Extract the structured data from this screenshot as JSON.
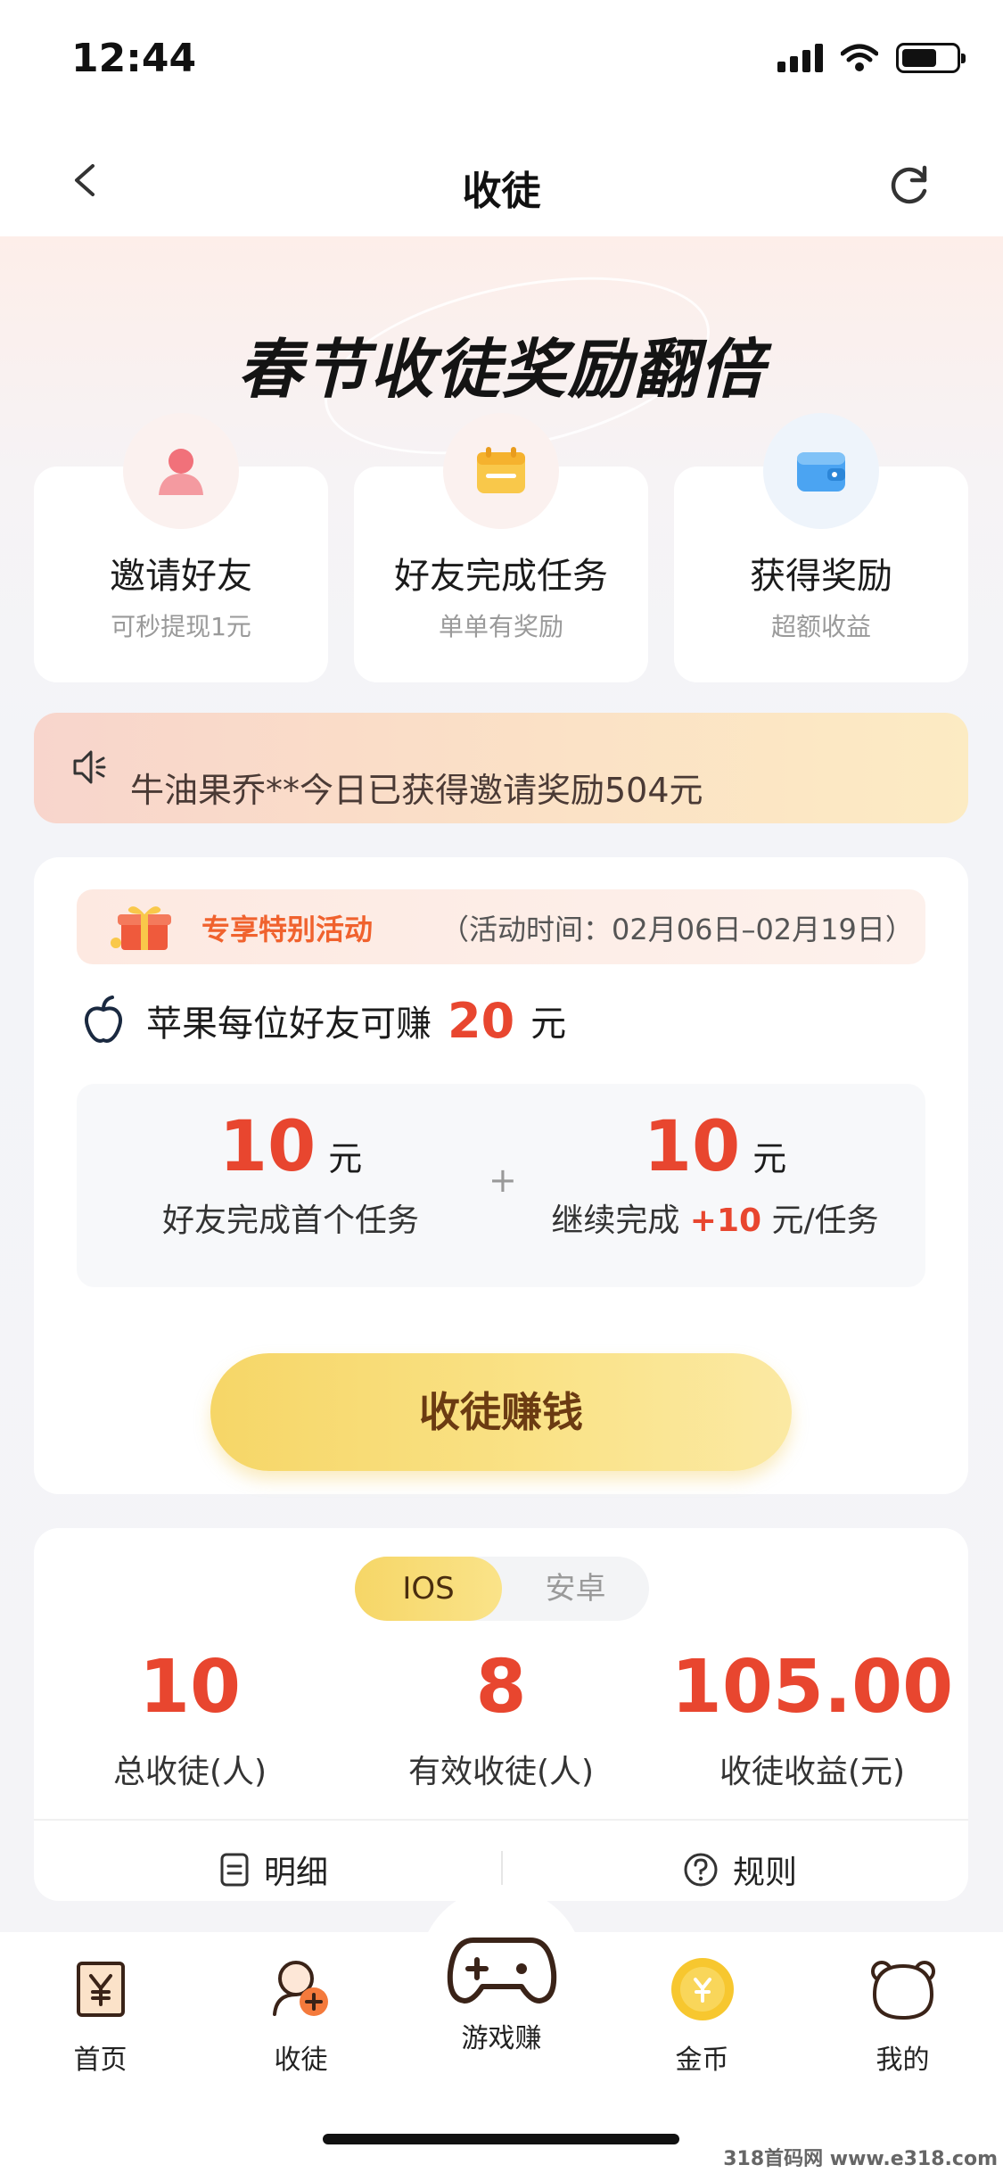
{
  "status_bar": {
    "time": "12:44"
  },
  "nav": {
    "title": "收徒"
  },
  "hero": {
    "title": "春节收徒奖励翻倍"
  },
  "steps": [
    {
      "title": "邀请好友",
      "subtitle": "可秒提现1元",
      "icon": "friend-avatar-icon"
    },
    {
      "title": "好友完成任务",
      "subtitle": "单单有奖励",
      "icon": "task-calendar-icon"
    },
    {
      "title": "获得奖励",
      "subtitle": "超额收益",
      "icon": "wallet-icon"
    }
  ],
  "ticker": {
    "text": "牛油果乔**今日已获得邀请奖励504元",
    "icon": "speaker-icon"
  },
  "activity": {
    "name": "专享特别活动",
    "time": "（活动时间：02月06日–02月19日）",
    "apple_text": "苹果每位好友可赚",
    "apple_amount": "20",
    "apple_unit": "元",
    "reward_left_value": "10",
    "reward_left_unit": "元",
    "reward_left_desc": "好友完成首个任务",
    "reward_plus": "+",
    "reward_right_value": "10",
    "reward_right_unit": "元",
    "reward_right_desc_prefix": "继续完成 ",
    "reward_right_desc_highlight": "+10",
    "reward_right_desc_suffix": " 元/任务",
    "cta_label": "收徒赚钱"
  },
  "stats": {
    "tabs": [
      "IOS",
      "安卓"
    ],
    "active_tab": "IOS",
    "items": [
      {
        "value": "10",
        "label": "总收徒(人)"
      },
      {
        "value": "8",
        "label": "有效收徒(人)"
      },
      {
        "value": "105.00",
        "label": "收徒收益(元)"
      }
    ],
    "detail_label": "明细",
    "rules_label": "规则"
  },
  "tabbar": [
    {
      "label": "首页",
      "icon": "home-yen-icon"
    },
    {
      "label": "收徒",
      "icon": "recruit-icon"
    },
    {
      "label": "游戏赚",
      "icon": "gamepad-icon"
    },
    {
      "label": "金币",
      "icon": "coin-icon"
    },
    {
      "label": "我的",
      "icon": "bear-profile-icon"
    }
  ],
  "watermark": "318首码网 www.e318.com",
  "colors": {
    "accent_red": "#e8462f",
    "cta_gold": "#f6d667",
    "orange": "#f0622e"
  }
}
